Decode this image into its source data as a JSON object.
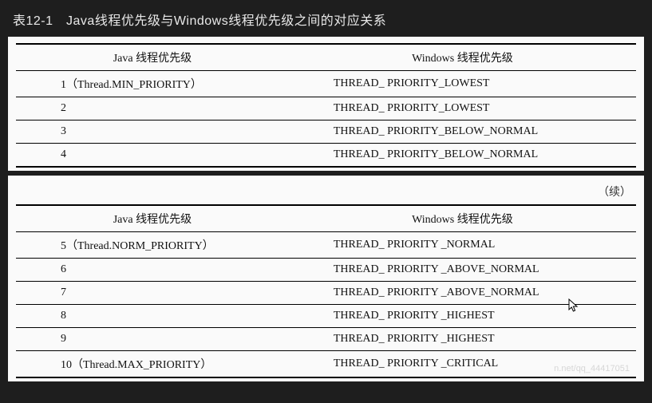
{
  "title": "表12-1　Java线程优先级与Windows线程优先级之间的对应关系",
  "headers": {
    "java": "Java 线程优先级",
    "windows": "Windows 线程优先级"
  },
  "continued_label": "（续）",
  "table1_rows": [
    {
      "java": "1（Thread.MIN_PRIORITY）",
      "windows": "THREAD_ PRIORITY_LOWEST"
    },
    {
      "java": "2",
      "windows": "THREAD_ PRIORITY_LOWEST"
    },
    {
      "java": "3",
      "windows": "THREAD_ PRIORITY_BELOW_NORMAL"
    },
    {
      "java": "4",
      "windows": "THREAD_ PRIORITY_BELOW_NORMAL"
    }
  ],
  "table2_rows": [
    {
      "java": "5（Thread.NORM_PRIORITY）",
      "windows": "THREAD_ PRIORITY _NORMAL"
    },
    {
      "java": "6",
      "windows": "THREAD_ PRIORITY _ABOVE_NORMAL"
    },
    {
      "java": "7",
      "windows": "THREAD_ PRIORITY _ABOVE_NORMAL"
    },
    {
      "java": "8",
      "windows": "THREAD_ PRIORITY _HIGHEST"
    },
    {
      "java": "9",
      "windows": "THREAD_ PRIORITY _HIGHEST"
    },
    {
      "java": "10（Thread.MAX_PRIORITY）",
      "windows": "THREAD_ PRIORITY _CRITICAL"
    }
  ],
  "watermark": "n.net/qq_44417051",
  "chart_data": {
    "type": "table",
    "title": "表12-1 Java线程优先级与Windows线程优先级之间的对应关系",
    "columns": [
      "Java 线程优先级",
      "Windows 线程优先级"
    ],
    "rows": [
      [
        "1（Thread.MIN_PRIORITY）",
        "THREAD_PRIORITY_LOWEST"
      ],
      [
        "2",
        "THREAD_PRIORITY_LOWEST"
      ],
      [
        "3",
        "THREAD_PRIORITY_BELOW_NORMAL"
      ],
      [
        "4",
        "THREAD_PRIORITY_BELOW_NORMAL"
      ],
      [
        "5（Thread.NORM_PRIORITY）",
        "THREAD_PRIORITY_NORMAL"
      ],
      [
        "6",
        "THREAD_PRIORITY_ABOVE_NORMAL"
      ],
      [
        "7",
        "THREAD_PRIORITY_ABOVE_NORMAL"
      ],
      [
        "8",
        "THREAD_PRIORITY_HIGHEST"
      ],
      [
        "9",
        "THREAD_PRIORITY_HIGHEST"
      ],
      [
        "10（Thread.MAX_PRIORITY）",
        "THREAD_PRIORITY_CRITICAL"
      ]
    ]
  }
}
